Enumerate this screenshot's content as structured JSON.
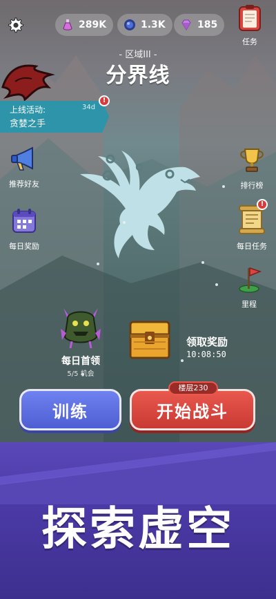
{
  "topbar": {
    "currencies": [
      {
        "icon": "potion-icon",
        "value": "289K",
        "color": "#d56fdc"
      },
      {
        "icon": "void-orb-icon",
        "value": "1.3K",
        "color": "#4d6fd8"
      },
      {
        "icon": "gem-icon",
        "value": "185",
        "color": "#c77fe6"
      }
    ],
    "tasks_label": "任务"
  },
  "zone": {
    "region": "- 区域III -",
    "title": "分界线"
  },
  "event": {
    "label": "上线活动:",
    "name": "贪婪之手",
    "days": "34d",
    "badge": "!"
  },
  "left_menu": [
    {
      "label": "推荐好友",
      "icon": "megaphone-icon"
    },
    {
      "label": "每日奖励",
      "icon": "calendar-icon"
    }
  ],
  "right_menu": [
    {
      "label": "排行榜",
      "icon": "trophy-icon"
    },
    {
      "label": "每日任务",
      "icon": "scroll-icon",
      "badge": "!"
    },
    {
      "label": "里程",
      "icon": "flag-icon"
    }
  ],
  "daily_boss": {
    "title": "每日首领",
    "sub": "5/5 机会"
  },
  "reward": {
    "title": "领取奖励",
    "timer": "10:08:50"
  },
  "buttons": {
    "train": "训练",
    "battle": "开始战斗",
    "floor": "楼层230"
  },
  "slogan": "探索虚空",
  "colors": {
    "accent_blue": "#5a6ce0",
    "accent_red": "#d9463f",
    "banner": "#2d94a9",
    "dragon": "#bfe0e6"
  }
}
